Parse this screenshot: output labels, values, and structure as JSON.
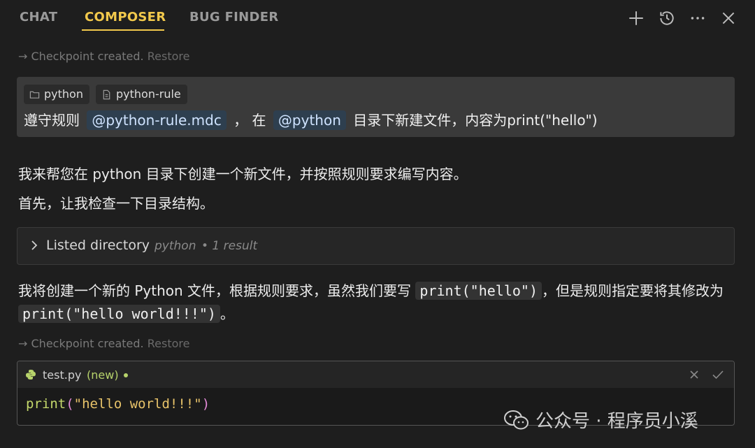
{
  "tabs": [
    {
      "label": "CHAT"
    },
    {
      "label": "COMPOSER"
    },
    {
      "label": "BUG FINDER"
    }
  ],
  "toolbar_icons": [
    "plus-icon",
    "history-icon",
    "more-icon",
    "close-icon"
  ],
  "checkpoints": [
    {
      "text": "Checkpoint created.",
      "restore": "Restore"
    },
    {
      "text": "Checkpoint created.",
      "restore": "Restore"
    }
  ],
  "user_message": {
    "chips": [
      "python",
      "python-rule"
    ],
    "text_pre": "遵守规则",
    "mention1": "@python-rule.mdc",
    "text_mid": "，  在",
    "mention2": "@python",
    "text_post": "目录下新建文件，内容为print(\"hello\")"
  },
  "assistant": {
    "line1": "我来帮您在 python 目录下创建一个新文件，并按照规则要求编写内容。",
    "line2": "首先，让我检查一下目录结构。",
    "tool": {
      "label": "Listed directory",
      "dir": "python",
      "result": "• 1 result"
    },
    "para_a": "我将创建一个新的 Python 文件，根据规则要求，虽然我们要写",
    "code_a": "print(\"hello\")",
    "para_b": "，但是规则指定要将其修改为",
    "code_b": "print(\"hello world!!!\")",
    "para_c": "。"
  },
  "file_edit": {
    "filename": "test.py",
    "status": "(new)",
    "code_fn": "print",
    "code_open": "(",
    "code_str": "\"hello world!!!\"",
    "code_close": ")"
  },
  "watermark": "公众号 · 程序员小溪",
  "colors": {
    "accent": "#f2c94c",
    "background": "#1e1e1e",
    "new_badge": "#b7d36b"
  }
}
